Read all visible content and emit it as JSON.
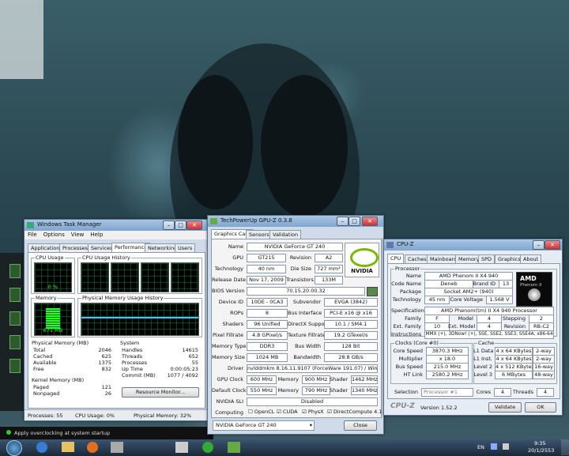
{
  "gpuz": {
    "title": "TechPowerUp GPU-Z 0.3.8",
    "tabs": [
      "Graphics Card",
      "Sensors",
      "Validation"
    ],
    "fields": [
      {
        "label": "Name",
        "value": "NVIDIA GeForce GT 240"
      },
      {
        "label": "GPU",
        "value": "GT215"
      },
      {
        "label": "Revision",
        "value": "A2"
      },
      {
        "label": "Technology",
        "value": "40 nm"
      },
      {
        "label": "Die Size",
        "value": "727 mm²"
      },
      {
        "label": "Release Date",
        "value": "Nov 17, 2009"
      },
      {
        "label": "Transistors",
        "value": "133M"
      },
      {
        "label": "BIOS Version",
        "value": "70.15.20.00.32"
      },
      {
        "label": "Device ID",
        "value": "10DE - 0CA3"
      },
      {
        "label": "Subvendor",
        "value": "EVGA (3842)"
      },
      {
        "label": "ROPs",
        "value": "8"
      },
      {
        "label": "Bus Interface",
        "value": "PCI-E x16 @ x16"
      },
      {
        "label": "Shaders",
        "value": "96 Unified"
      },
      {
        "label": "DirectX Support",
        "value": "10.1 / SM4.1"
      },
      {
        "label": "Pixel Fillrate",
        "value": "4.8 GPixel/s"
      },
      {
        "label": "Texture Fillrate",
        "value": "19.2 GTexel/s"
      },
      {
        "label": "Memory Type",
        "value": "DDR3"
      },
      {
        "label": "Bus Width",
        "value": "128 Bit"
      },
      {
        "label": "Memory Size",
        "value": "1024 MB"
      },
      {
        "label": "Bandwidth",
        "value": "28.8 GB/s"
      },
      {
        "label": "Driver",
        "value": "nvlddmkm 8.16.11.9107 (ForceWare 191.07) / Win7"
      },
      {
        "label": "GPU Clock",
        "value": "600 MHz"
      },
      {
        "label": "Memory",
        "value": "900 MHz"
      },
      {
        "label": "Shader",
        "value": "1462 MHz"
      },
      {
        "label": "Default Clock",
        "value": "550 MHz"
      },
      {
        "label": "Memory",
        "value": "790 MHz"
      },
      {
        "label": "Shader",
        "value": "1340 MHz"
      },
      {
        "label": "NVIDIA SLI",
        "value": "Disabled"
      }
    ],
    "computing_label": "Computing",
    "computing": [
      {
        "label": "OpenCL",
        "checked": false
      },
      {
        "label": "CUDA",
        "checked": true
      },
      {
        "label": "PhysX",
        "checked": true
      },
      {
        "label": "DirectCompute 4.1",
        "checked": true
      }
    ],
    "select_value": "NVIDIA GeForce GT 240",
    "close_label": "Close",
    "logo_text": "NVIDIA"
  },
  "taskman": {
    "title": "Windows Task Manager",
    "menu": [
      "File",
      "Options",
      "View",
      "Help"
    ],
    "tabs": [
      "Applications",
      "Processes",
      "Services",
      "Performance",
      "Networking",
      "Users"
    ],
    "cpu_usage_label": "CPU Usage",
    "cpu_usage_value": "0 %",
    "cpu_history_label": "CPU Usage History",
    "memory_label": "Memory",
    "memory_value": "671 MB",
    "mem_history_label": "Physical Memory Usage History",
    "physmem_title": "Physical Memory (MB)",
    "physmem": [
      [
        "Total",
        "2046"
      ],
      [
        "Cached",
        "625"
      ],
      [
        "Available",
        "1375"
      ],
      [
        "Free",
        "832"
      ]
    ],
    "kernel_title": "Kernel Memory (MB)",
    "kernel": [
      [
        "Paged",
        "121"
      ],
      [
        "Nonpaged",
        "26"
      ]
    ],
    "system_title": "System",
    "system": [
      [
        "Handles",
        "14615"
      ],
      [
        "Threads",
        "652"
      ],
      [
        "Processes",
        "55"
      ],
      [
        "Up Time",
        "0:00:05:23"
      ],
      [
        "Commit (MB)",
        "1077 / 4092"
      ]
    ],
    "resource_button": "Resource Monitor...",
    "status": [
      "Processes: 55",
      "CPU Usage: 0%",
      "Physical Memory: 32%"
    ]
  },
  "cpuz": {
    "title": "CPU-Z",
    "tabs": [
      "CPU",
      "Caches",
      "Mainboard",
      "Memory",
      "SPD",
      "Graphics",
      "About"
    ],
    "processor_title": "Processor",
    "processor": [
      {
        "label": "Name",
        "value": "AMD Phenom II X4 940"
      },
      {
        "label": "Code Name",
        "value": "Deneb"
      },
      {
        "label": "Brand ID",
        "value": "13"
      },
      {
        "label": "Package",
        "value": "Socket AM2+ (940)"
      },
      {
        "label": "Technology",
        "value": "45 nm"
      },
      {
        "label": "Core Voltage",
        "value": "1.568 V"
      }
    ],
    "spec_label": "Specification",
    "spec": "AMD Phenom(tm) II X4 940 Processor",
    "family": [
      {
        "label": "Family",
        "value": "F"
      },
      {
        "label": "Model",
        "value": "4"
      },
      {
        "label": "Stepping",
        "value": "2"
      },
      {
        "label": "Ext. Family",
        "value": "10"
      },
      {
        "label": "Ext. Model",
        "value": "4"
      },
      {
        "label": "Revision",
        "value": "RB-C2"
      }
    ],
    "instructions_label": "Instructions",
    "instructions": "MMX (+), 3DNow! (+), SSE, SSE2, SSE3, SSE4A, x86-64",
    "clocks_title": "Clocks (Core #0)",
    "clocks": [
      {
        "label": "Core Speed",
        "value": "3870.3 MHz"
      },
      {
        "label": "Multiplier",
        "value": "x 18.0"
      },
      {
        "label": "Bus Speed",
        "value": "215.0 MHz"
      },
      {
        "label": "HT Link",
        "value": "2580.2 MHz"
      }
    ],
    "cache_title": "Cache",
    "cache": [
      {
        "label": "L1 Data",
        "value": "4 x 64 KBytes",
        "way": "2-way"
      },
      {
        "label": "L1 Inst.",
        "value": "4 x 64 KBytes",
        "way": "2-way"
      },
      {
        "label": "Level 2",
        "value": "4 x 512 KBytes",
        "way": "16-way"
      },
      {
        "label": "Level 3",
        "value": "6 MBytes",
        "way": "48-way"
      }
    ],
    "selection_label": "Selection",
    "selection_value": "Processor #1",
    "cores_label": "Cores",
    "cores": "4",
    "threads_label": "Threads",
    "threads": "4",
    "brand": "CPU-Z",
    "version": "Version 1.52.2",
    "validate": "Validate",
    "ok": "OK",
    "logo_text": "AMD",
    "logo_sub": "Phenom II"
  },
  "desktop": {
    "notification": "Apply overclocking at system startup",
    "lang": "EN",
    "time": "9:35",
    "date": "20/1/2553"
  }
}
